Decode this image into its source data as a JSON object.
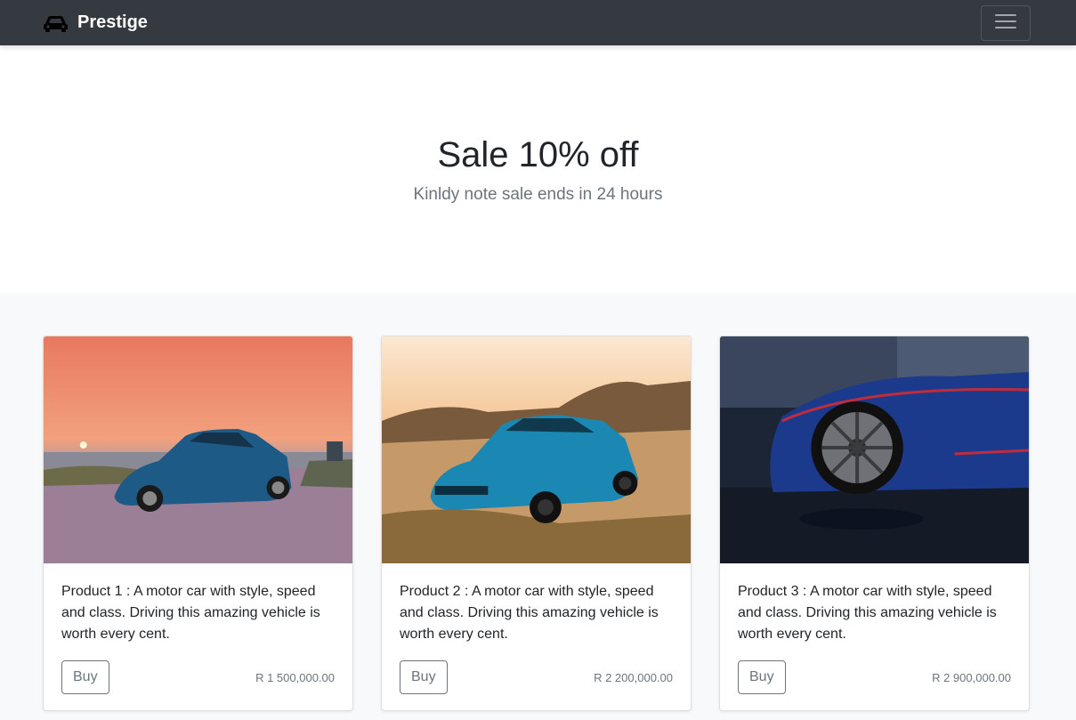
{
  "navbar": {
    "brand": "Prestige",
    "brand_icon": "car-icon",
    "toggler_icon": "hamburger-menu-icon",
    "background": "#343a40"
  },
  "hero": {
    "title": "Sale 10% off",
    "subtitle": "Kinldy note sale ends in 24 hours"
  },
  "products": [
    {
      "text": "Product 1 : A motor car with style, speed and class. Driving this amazing vehicle is worth every cent.",
      "button": "Buy",
      "price": "R 1 500,000.00",
      "image": "blue-coupe-at-sunset-photo"
    },
    {
      "text": "Product 2 : A motor car with style, speed and class. Driving this amazing vehicle is worth every cent.",
      "button": "Buy",
      "price": "R 2 200,000.00",
      "image": "blue-muscle-car-in-desert-photo"
    },
    {
      "text": "Product 3 : A motor car with style, speed and class. Driving this amazing vehicle is worth every cent.",
      "button": "Buy",
      "price": "R 2 900,000.00",
      "image": "blue-sports-car-wheel-closeup-photo"
    }
  ]
}
